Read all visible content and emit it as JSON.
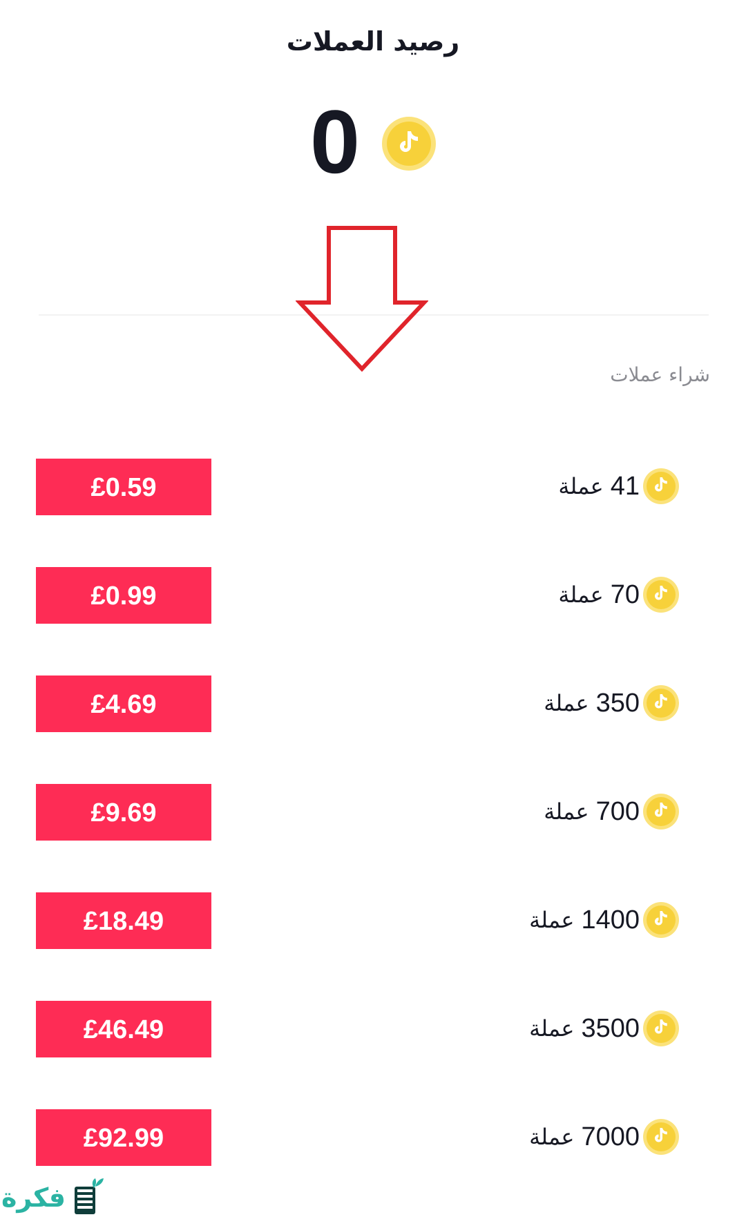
{
  "header": {
    "title": "رصيد العملات",
    "balance": "0"
  },
  "section": {
    "label": "شراء عملات"
  },
  "packages": [
    {
      "coins": "41",
      "unit": "عملة",
      "price": "£0.59"
    },
    {
      "coins": "70",
      "unit": "عملة",
      "price": "£0.99"
    },
    {
      "coins": "350",
      "unit": "عملة",
      "price": "£4.69"
    },
    {
      "coins": "700",
      "unit": "عملة",
      "price": "£9.69"
    },
    {
      "coins": "1400",
      "unit": "عملة",
      "price": "£18.49"
    },
    {
      "coins": "3500",
      "unit": "عملة",
      "price": "£46.49"
    },
    {
      "coins": "7000",
      "unit": "عملة",
      "price": "£92.99"
    }
  ],
  "watermark": {
    "text": "فكرة",
    "color": "#2bb3a3"
  },
  "colors": {
    "accent": "#fe2c55",
    "coin": "#f7d13a",
    "arrow": "#e0242b"
  }
}
